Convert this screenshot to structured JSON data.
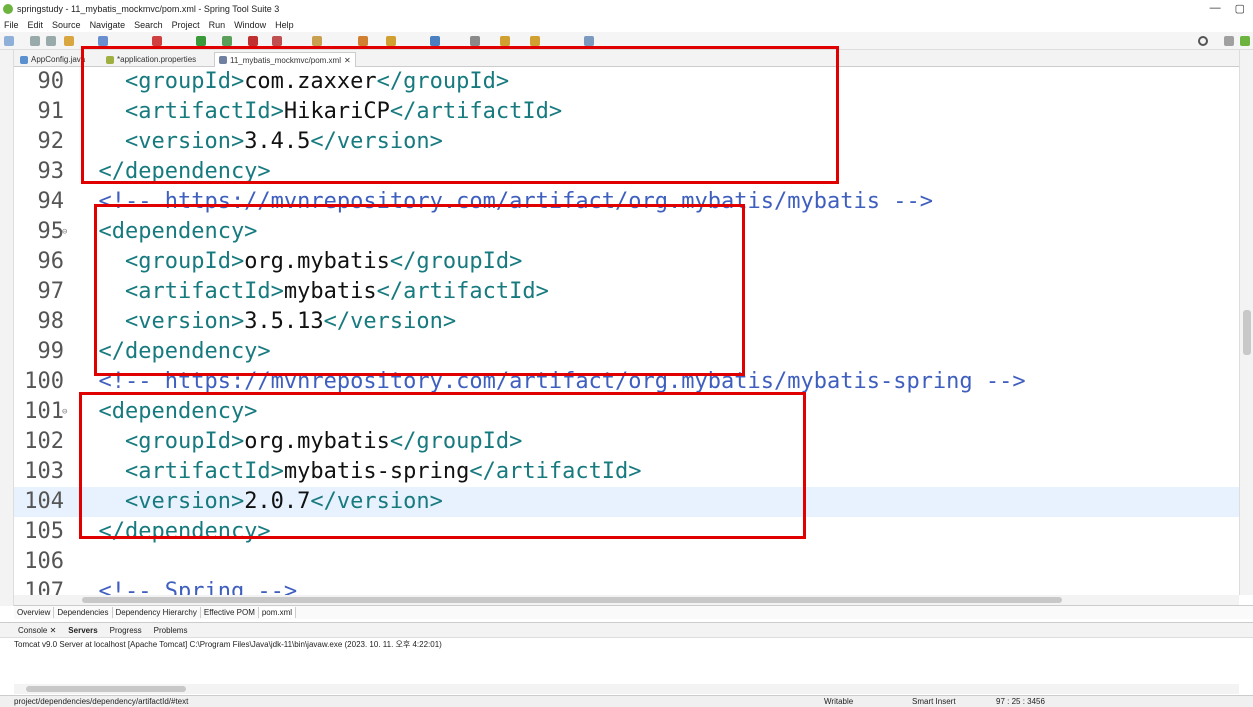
{
  "window": {
    "title": "springstudy - 11_mybatis_mockmvc/pom.xml - Spring Tool Suite 3",
    "minimize": "—",
    "restore": "▢"
  },
  "menu": [
    "File",
    "Edit",
    "Source",
    "Navigate",
    "Search",
    "Project",
    "Run",
    "Window",
    "Help"
  ],
  "tabs": [
    {
      "label": "AppConfig.java",
      "icon": "java-file-icon"
    },
    {
      "label": "*application.properties",
      "icon": "properties-file-icon"
    },
    {
      "label": "11_mybatis_mockmvc/pom.xml",
      "icon": "xml-file-icon",
      "active": true
    }
  ],
  "editor": {
    "lines": [
      {
        "n": "90",
        "parts": [
          [
            "tag",
            "    <groupId>"
          ],
          [
            "txt",
            "com.zaxxer"
          ],
          [
            "tag",
            "</groupId>"
          ]
        ]
      },
      {
        "n": "91",
        "parts": [
          [
            "tag",
            "    <artifactId>"
          ],
          [
            "txt",
            "HikariCP"
          ],
          [
            "tag",
            "</artifactId>"
          ]
        ]
      },
      {
        "n": "92",
        "parts": [
          [
            "tag",
            "    <version>"
          ],
          [
            "txt",
            "3.4.5"
          ],
          [
            "tag",
            "</version>"
          ]
        ]
      },
      {
        "n": "93",
        "parts": [
          [
            "tag",
            "  </dependency>"
          ]
        ]
      },
      {
        "n": "94",
        "parts": [
          [
            "cmt",
            "  <!-- https://mvnrepository.com/artifact/org.mybatis/mybatis -->"
          ]
        ]
      },
      {
        "n": "95",
        "fold": true,
        "parts": [
          [
            "tag",
            "  <dependency>"
          ]
        ]
      },
      {
        "n": "96",
        "parts": [
          [
            "tag",
            "    <groupId>"
          ],
          [
            "txt",
            "org.mybatis"
          ],
          [
            "tag",
            "</groupId>"
          ]
        ]
      },
      {
        "n": "97",
        "parts": [
          [
            "tag",
            "    <artifactId>"
          ],
          [
            "txt",
            "mybatis"
          ],
          [
            "tag",
            "</artifactId>"
          ]
        ]
      },
      {
        "n": "98",
        "parts": [
          [
            "tag",
            "    <version>"
          ],
          [
            "txt",
            "3.5.13"
          ],
          [
            "tag",
            "</version>"
          ]
        ]
      },
      {
        "n": "99",
        "parts": [
          [
            "tag",
            "  </dependency>"
          ]
        ]
      },
      {
        "n": "100",
        "parts": [
          [
            "cmt",
            "  <!-- https://mvnrepository.com/artifact/org.mybatis/mybatis-spring -->"
          ]
        ]
      },
      {
        "n": "101",
        "fold": true,
        "parts": [
          [
            "tag",
            "  <dependency>"
          ]
        ]
      },
      {
        "n": "102",
        "parts": [
          [
            "tag",
            "    <groupId>"
          ],
          [
            "txt",
            "org.mybatis"
          ],
          [
            "tag",
            "</groupId>"
          ]
        ]
      },
      {
        "n": "103",
        "parts": [
          [
            "tag",
            "    <artifactId>"
          ],
          [
            "txt",
            "mybatis-spring"
          ],
          [
            "tag",
            "</artifactId>"
          ]
        ]
      },
      {
        "n": "104",
        "current": true,
        "parts": [
          [
            "tag",
            "    <version>"
          ],
          [
            "txt",
            "2.0.7"
          ],
          [
            "tag",
            "</version>"
          ]
        ]
      },
      {
        "n": "105",
        "parts": [
          [
            "tag",
            "  </dependency>"
          ]
        ]
      },
      {
        "n": "106",
        "parts": []
      },
      {
        "n": "107",
        "parts": [
          [
            "cmt",
            "  <!-- Spring -->"
          ]
        ]
      }
    ]
  },
  "pom_tabs": [
    "Overview",
    "Dependencies",
    "Dependency Hierarchy",
    "Effective POM",
    "pom.xml"
  ],
  "console": {
    "tabs": [
      "Console",
      "Servers",
      "Progress",
      "Problems"
    ],
    "text": "Tomcat v9.0 Server at localhost [Apache Tomcat] C:\\Program Files\\Java\\jdk-11\\bin\\javaw.exe  (2023. 10. 11. 오후 4:22:01)"
  },
  "status": {
    "path": "project/dependencies/dependency/artifactId/#text",
    "mode": "Writable",
    "insert": "Smart Insert",
    "position": "97 : 25 : 3456"
  },
  "colors": {
    "tag": "#177a7f",
    "comment": "#3f5fbf",
    "highlight_box": "#e00000",
    "current_line": "#e8f2fe"
  }
}
